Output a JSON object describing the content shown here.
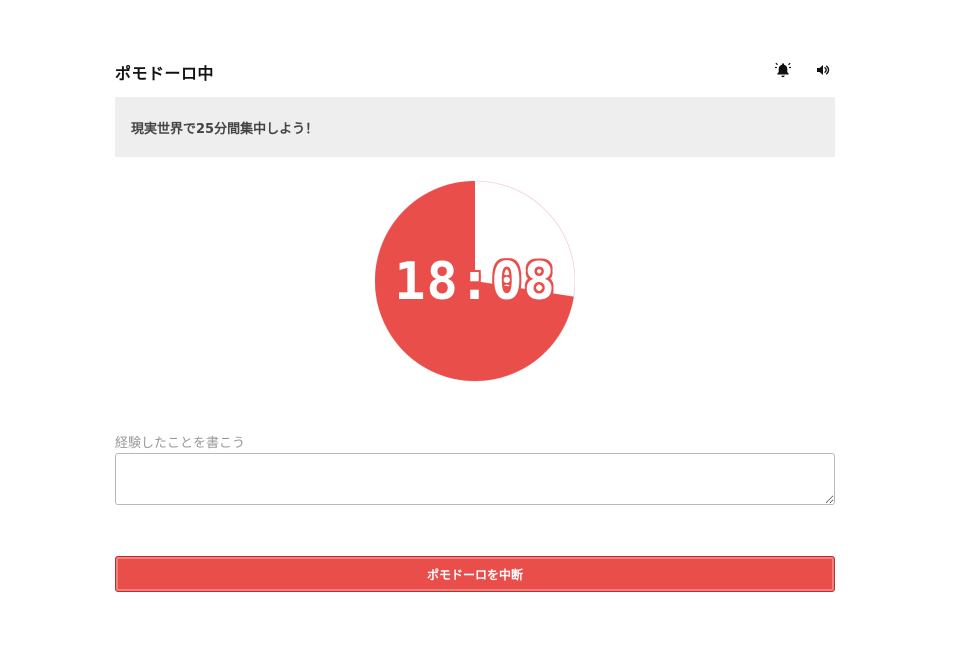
{
  "header": {
    "title": "ポモドーロ中",
    "icons": [
      "bell-icon",
      "speaker-icon"
    ]
  },
  "message": {
    "text": "現実世界で25分間集中しよう！"
  },
  "timer": {
    "display": "18:08",
    "elapsed_fraction": 0.275,
    "accent_color": "#e94e4b"
  },
  "notes": {
    "label": "経験したことを書こう",
    "value": ""
  },
  "actions": {
    "stop_label": "ポモドーロを中断",
    "button_color": "#e94e4b"
  }
}
